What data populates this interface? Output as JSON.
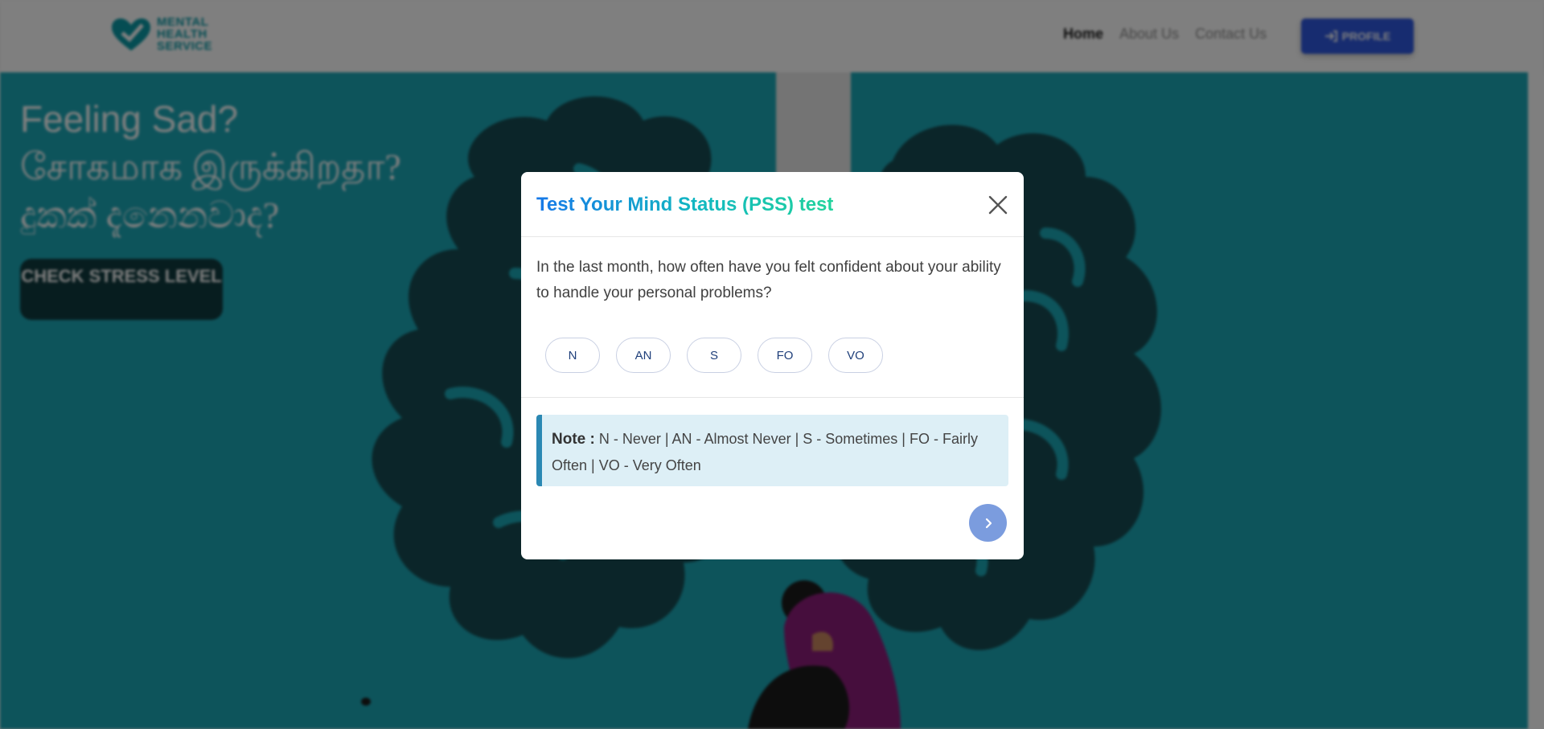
{
  "navbar": {
    "logo_lines": [
      "MENTAL",
      "HEALTH",
      "SERVICE"
    ],
    "links": [
      {
        "label": "Home",
        "active": true
      },
      {
        "label": "About Us",
        "active": false
      },
      {
        "label": "Contact Us",
        "active": false
      }
    ],
    "profile_label": "PROFILE",
    "profile_icon": "sign-in-icon"
  },
  "hero": {
    "title_lines": [
      "Feeling Sad?",
      "சோகமாக இருக்கிறதா?",
      "දුකක් දැනෙනවාද?"
    ],
    "cta_label": "CHECK STRESS LEVEL",
    "background_color": "#1ba8b7"
  },
  "modal": {
    "title": "Test Your Mind Status (PSS) test",
    "close_icon": "close-icon",
    "question": "In the last month, how often have you felt confident about your ability to handle your personal problems?",
    "options": [
      "N",
      "AN",
      "S",
      "FO",
      "VO"
    ],
    "note_label": "Note :",
    "note_text": "N - Never | AN - Almost Never | S - Sometimes | FO - Fairly Often | VO - Very Often",
    "next_icon": "chevron-right-icon",
    "title_gradient": [
      "#1678e8",
      "#12b8c0",
      "#21d39c"
    ],
    "accent_color": "#7b9cde"
  }
}
